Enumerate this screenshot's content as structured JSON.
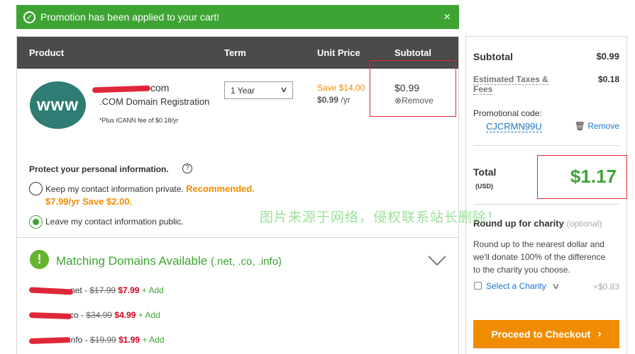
{
  "banner": {
    "message": "Promotion has been applied to your cart!",
    "close": "×"
  },
  "table": {
    "headers": {
      "product": "Product",
      "term": "Term",
      "unit_price": "Unit Price",
      "subtotal": "Subtotal"
    }
  },
  "item": {
    "logo_text": "www",
    "domain_suffix": "com",
    "name": ".COM Domain Registration",
    "fee_note": "*Plus ICANN fee of $0.18/yr",
    "term": "1 Year",
    "save": "Save $14.00",
    "unit_price": "$0.99",
    "unit_per": "/yr",
    "subtotal": "$0.99",
    "remove": "Remove"
  },
  "privacy": {
    "title": "Protect your personal information.",
    "help": "?",
    "option_private": "Keep my contact information private.",
    "recommended": "Recommended.",
    "private_price": "$7.99/yr Save $2.00.",
    "option_public": "Leave my contact information public."
  },
  "matching": {
    "icon": "!",
    "title": "Matching Domains Available",
    "exts": "(.net, .co, .info)",
    "rows": [
      {
        "suffix": "net",
        "old": "$17.99",
        "new": "$7.99",
        "add": "+ Add"
      },
      {
        "suffix": "co",
        "old": "$34.99",
        "new": "$4.99",
        "add": "+ Add"
      },
      {
        "suffix": "info",
        "old": "$19.99",
        "new": "$1.99",
        "add": "+ Add"
      }
    ],
    "separator": " - "
  },
  "summary": {
    "subtotal_label": "Subtotal",
    "subtotal_value": "$0.99",
    "taxes_label_1": "Estimated Taxes &",
    "taxes_label_2": "Fees",
    "taxes_value": "$0.18",
    "promo_label": "Promotional code:",
    "promo_code": "CJCRMN99U",
    "promo_remove": "Remove",
    "total_label": "Total",
    "total_currency": "(USD)",
    "total_value": "$1.17",
    "charity_title": "Round up for charity",
    "charity_optional": "(optional)",
    "charity_text_1": "Round up to the nearest dollar and",
    "charity_text_2": "we'll donate 100% of the difference",
    "charity_text_3": "to the charity you choose.",
    "charity_select": "Select a Charity",
    "charity_amount": "+$0.83",
    "checkout": "Proceed to Checkout"
  },
  "watermark": "图片来源于网络，侵权联系站长删除！",
  "colors": {
    "green": "#3da434",
    "orange": "#f08c00",
    "red": "#d0021b",
    "header": "#4b4b4b",
    "blue": "#1a73c9"
  }
}
